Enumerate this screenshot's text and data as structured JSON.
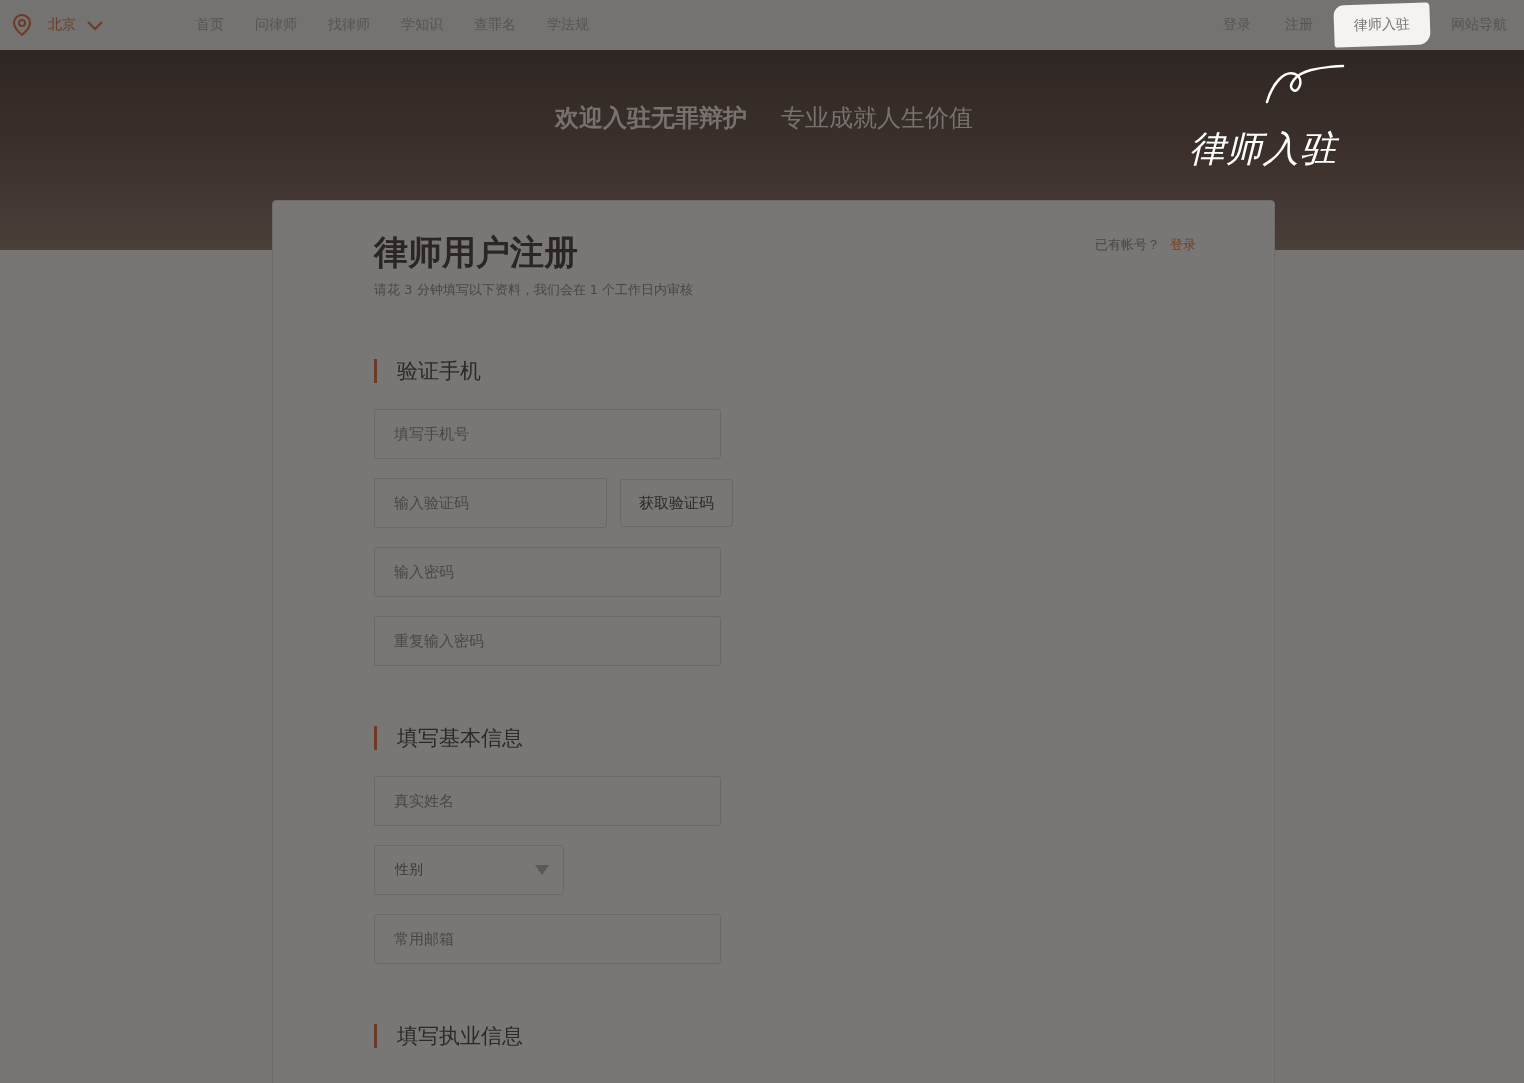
{
  "header": {
    "city": "北京",
    "nav": [
      {
        "label": "首页"
      },
      {
        "label": "问律师"
      },
      {
        "label": "找律师"
      },
      {
        "label": "学知识"
      },
      {
        "label": "查罪名"
      },
      {
        "label": "学法规"
      }
    ],
    "account_links": [
      {
        "label": "登录",
        "selected": false
      },
      {
        "label": "注册",
        "selected": false
      },
      {
        "label": "律师入驻",
        "selected": true
      },
      {
        "label": "网站导航",
        "selected": false
      }
    ]
  },
  "banner": {
    "headline": "欢迎入驻无罪辩护",
    "tagline": "专业成就人生价值",
    "handwriting": "律师入驻"
  },
  "form": {
    "title": "律师用户注册",
    "subtitle": "请花 3 分钟填写以下资料，我们会在 1 个工作日内审核",
    "login_prompt": "已有帐号？",
    "login_link": "登录",
    "sections": [
      {
        "title": "验证手机",
        "fields": [
          {
            "kind": "text",
            "placeholder": "填写手机号"
          },
          {
            "kind": "code",
            "placeholder": "输入验证码",
            "button": "获取验证码"
          },
          {
            "kind": "text",
            "placeholder": "输入密码"
          },
          {
            "kind": "text",
            "placeholder": "重复输入密码"
          }
        ]
      },
      {
        "title": "填写基本信息",
        "fields": [
          {
            "kind": "text",
            "placeholder": "真实姓名"
          },
          {
            "kind": "select",
            "value": "性别"
          },
          {
            "kind": "text",
            "placeholder": "常用邮箱"
          }
        ]
      },
      {
        "title": "填写执业信息"
      }
    ]
  }
}
